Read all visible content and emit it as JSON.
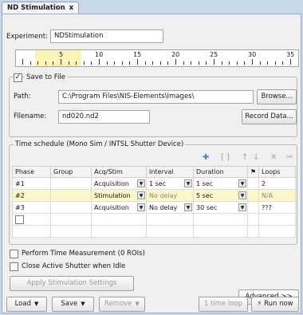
{
  "tab": {
    "title": "ND Stimulation",
    "close": "x"
  },
  "experiment": {
    "label": "Experiment:",
    "value": "NDStimulation"
  },
  "ruler": {
    "labels": [
      "5",
      "10",
      "15",
      "20",
      "25",
      "30",
      "35"
    ]
  },
  "save": {
    "checkbox_label": "Save to File",
    "checked": "✓",
    "path_label": "Path:",
    "path_value": "C:\\Program Files\\NIS-Elements\\Images\\",
    "browse_label": "Browse...",
    "filename_label": "Filename:",
    "filename_value": "nd020.nd2",
    "record_label": "Record Data..."
  },
  "schedule": {
    "title": "Time schedule (Mono Sim / INTSL Shutter Device)",
    "toolbar_icons": [
      "add-icon",
      "bracket-icon",
      "move-up-icon",
      "move-down-icon",
      "delete-icon",
      "scissors-icon"
    ],
    "columns": [
      "Phase",
      "Group",
      "Acq/Stim",
      "Interval",
      "Duration",
      "⚑",
      "Loops"
    ],
    "rows": [
      {
        "phase": "#1",
        "group": "",
        "acq": "Acquisition",
        "interval": "1 sec",
        "duration": "1 sec",
        "loops": "2"
      },
      {
        "phase": "#2",
        "group": "",
        "acq": "Stimulation",
        "interval": "No delay",
        "duration": "5 sec",
        "loops": "N/A"
      },
      {
        "phase": "#3",
        "group": "",
        "acq": "Acquisition",
        "interval": "No delay",
        "duration": "30 sec",
        "loops": "???"
      }
    ]
  },
  "options": {
    "perform_label": "Perform Time Measurement (0 ROIs)",
    "close_label": "Close Active Shutter when Idle",
    "apply_label": "Apply Stimulation Settings"
  },
  "footer": {
    "advanced_label": "Advanced >>",
    "load_label": "Load",
    "save_label": "Save",
    "remove_label": "Remove",
    "time_loop_label": "1 time loop",
    "run_label": "Run now"
  }
}
